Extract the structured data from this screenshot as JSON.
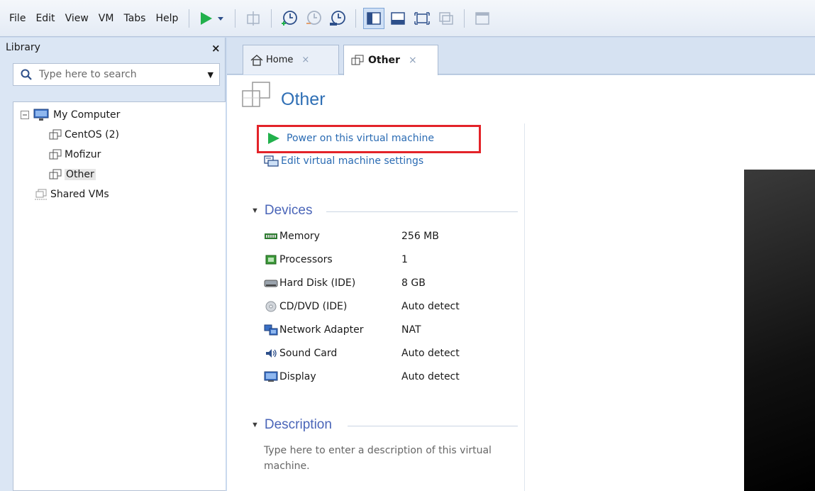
{
  "menu": [
    "File",
    "Edit",
    "View",
    "VM",
    "Tabs",
    "Help"
  ],
  "library": {
    "title": "Library",
    "close": "×",
    "search_placeholder": "Type here to search",
    "tree": {
      "root": "My Computer",
      "vms": [
        "CentOS (2)",
        "Mofizur",
        "Other"
      ],
      "shared": "Shared VMs"
    }
  },
  "tabs": [
    {
      "label": "Home",
      "close": "×"
    },
    {
      "label": "Other",
      "close": "×"
    }
  ],
  "vm": {
    "title": "Other",
    "power_on": "Power on this virtual machine",
    "edit_settings": "Edit virtual machine settings"
  },
  "devices": {
    "heading": "Devices",
    "items": [
      {
        "name": "Memory",
        "value": "256 MB",
        "icon": "memory-icon"
      },
      {
        "name": "Processors",
        "value": "1",
        "icon": "processor-icon"
      },
      {
        "name": "Hard Disk (IDE)",
        "value": "8 GB",
        "icon": "hard-disk-icon"
      },
      {
        "name": "CD/DVD (IDE)",
        "value": "Auto detect",
        "icon": "cd-dvd-icon"
      },
      {
        "name": "Network Adapter",
        "value": "NAT",
        "icon": "network-adapter-icon"
      },
      {
        "name": "Sound Card",
        "value": "Auto detect",
        "icon": "sound-card-icon"
      },
      {
        "name": "Display",
        "value": "Auto detect",
        "icon": "display-icon"
      }
    ]
  },
  "description": {
    "heading": "Description",
    "placeholder": "Type here to enter a description of this virtual machine."
  },
  "colors": {
    "accent": "#2f6fb5",
    "highlight_box": "#e32329",
    "play_green": "#22b14c"
  }
}
